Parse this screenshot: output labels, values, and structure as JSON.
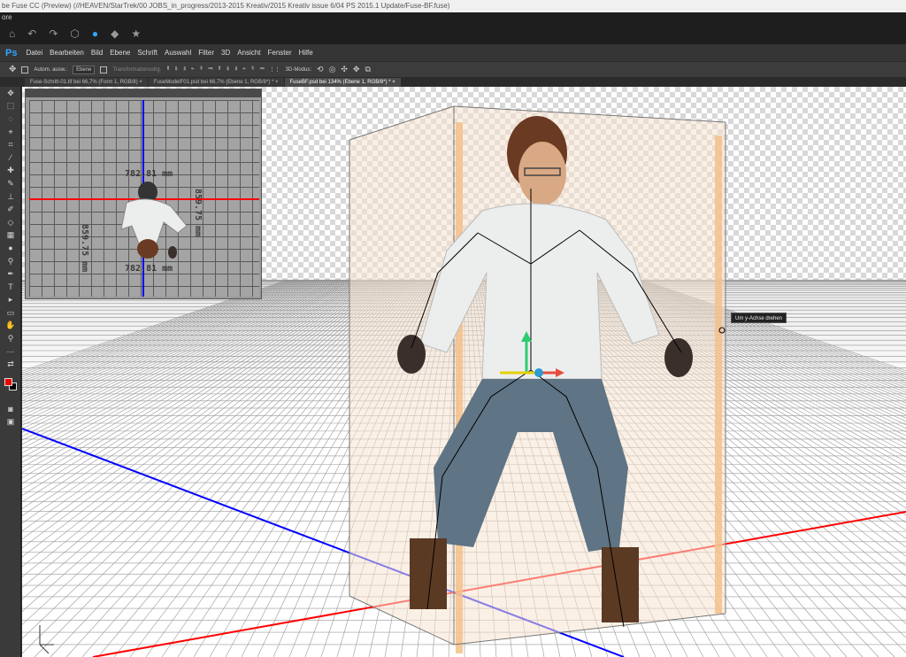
{
  "window": {
    "title": "be Fuse CC (Preview) (//HEAVEN/StarTrek/00 JOBS_in_progress/2013-2015 Kreativ/2015 Kreativ issue 6/04 PS 2015.1 Update/Fuse-BF.fuse)",
    "subtitle": "ore"
  },
  "menubar": {
    "logo": "Ps",
    "items": [
      "Datei",
      "Bearbeiten",
      "Bild",
      "Ebene",
      "Schrift",
      "Auswahl",
      "Filter",
      "3D",
      "Ansicht",
      "Fenster",
      "Hilfe"
    ]
  },
  "options": {
    "auto_select_label": "Autom. ausw.:",
    "layer_select": "Ebene",
    "transform_label": "Transformationsstrg.",
    "mode_label": "3D-Modus:"
  },
  "tabs": [
    {
      "label": "Fuse-Schritt-01.tif bei 66,7% (Form 1, RGB/8)",
      "close": "×"
    },
    {
      "label": "FuseModelF01.psd bei 66,7% (Ebene 1, RGB/8*) *",
      "close": "×"
    },
    {
      "label": "FuseBF.psd bei 134% (Ebene 1, RGB/8*) *",
      "close": "×"
    }
  ],
  "secondary_view": {
    "dim_top": "782.81 mm",
    "dim_bottom": "782.81 mm",
    "dim_left": "859.75 mm",
    "dim_right": "859.75 mm"
  },
  "tooltip": "Um y-Achse drehen",
  "colors": {
    "foreground": "#ee0000",
    "background": "#000000",
    "x_axis": "#ff0000",
    "z_axis": "#0000ff",
    "bounding_box": "#f5c08a"
  }
}
